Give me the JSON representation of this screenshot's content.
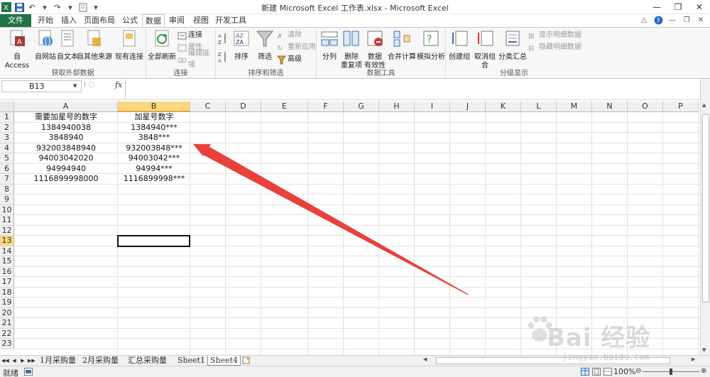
{
  "window": {
    "title": "新建 Microsoft Excel 工作表.xlsx - Microsoft Excel",
    "controls": {
      "minimize": "—",
      "restore": "❐",
      "close": "✕"
    }
  },
  "qat": {
    "save": "💾",
    "undo": "↶",
    "redo": "↷",
    "more": "▾"
  },
  "tabs": [
    {
      "label": "文件"
    },
    {
      "label": "开始"
    },
    {
      "label": "插入"
    },
    {
      "label": "页面布局"
    },
    {
      "label": "公式"
    },
    {
      "label": "数据"
    },
    {
      "label": "审阅"
    },
    {
      "label": "视图"
    },
    {
      "label": "开发工具"
    }
  ],
  "active_tab": "数据",
  "ribbon": {
    "groups": {
      "external": {
        "label": "获取外部数据",
        "buttons": [
          "自 Access",
          "自网站",
          "自文本",
          "自其他来源",
          "现有连接"
        ]
      },
      "connections": {
        "label": "连接",
        "big": "全部刷新",
        "small": [
          "连接",
          "属性",
          "编辑链接"
        ]
      },
      "sort_filter": {
        "label": "排序和筛选",
        "big": [
          "排序",
          "筛选"
        ],
        "small": [
          "清除",
          "重新应用",
          "高级"
        ]
      },
      "data_tools": {
        "label": "数据工具",
        "buttons": [
          "分列",
          "删除\n重复项",
          "数据\n有效性",
          "合并计算",
          "模拟分析"
        ]
      },
      "outline": {
        "label": "分级显示",
        "buttons": [
          "创建组",
          "取消组合",
          "分类汇总"
        ],
        "small": [
          "显示明细数据",
          "隐藏明细数据"
        ]
      }
    }
  },
  "formula_bar": {
    "name_box": "B13",
    "fx": "fx",
    "formula": ""
  },
  "sheet": {
    "columns": [
      "A",
      "B",
      "C",
      "D",
      "E",
      "F",
      "G",
      "H",
      "I",
      "J",
      "K",
      "L",
      "M",
      "N",
      "O",
      "P"
    ],
    "selected_column": "B",
    "selected_row": "13",
    "rows": [
      "1",
      "2",
      "3",
      "4",
      "5",
      "6",
      "7",
      "8",
      "9",
      "10",
      "11",
      "12",
      "13",
      "14",
      "15",
      "16",
      "17",
      "18",
      "19",
      "20",
      "21",
      "22",
      "23"
    ],
    "cells": [
      {
        "a": "需要加星号的数字",
        "b": "加星号数字"
      },
      {
        "a": "1384940038",
        "b": "1384940***"
      },
      {
        "a": "3848940",
        "b": "3848***"
      },
      {
        "a": "932003848940",
        "b": "932003848***"
      },
      {
        "a": "94003042020",
        "b": "94003042***"
      },
      {
        "a": "94994940",
        "b": "94994***"
      },
      {
        "a": "1116899998000",
        "b": "1116899998***"
      }
    ]
  },
  "sheet_tabs": {
    "nav": [
      "◀◀",
      "◀",
      "▶",
      "▶▶"
    ],
    "tabs": [
      "1月采购量",
      "2月采购量",
      "汇总采购量",
      "Sheet1",
      "Sheet4"
    ],
    "active": "Sheet4"
  },
  "status": {
    "ready": "就绪",
    "zoom": "100%"
  },
  "watermark": {
    "text": "Bai 经验",
    "url": "jingyan.baidu.com"
  },
  "colors": {
    "file_tab": "#217346",
    "arrow": "#e8403a",
    "header_selected": "#f9d77e"
  }
}
